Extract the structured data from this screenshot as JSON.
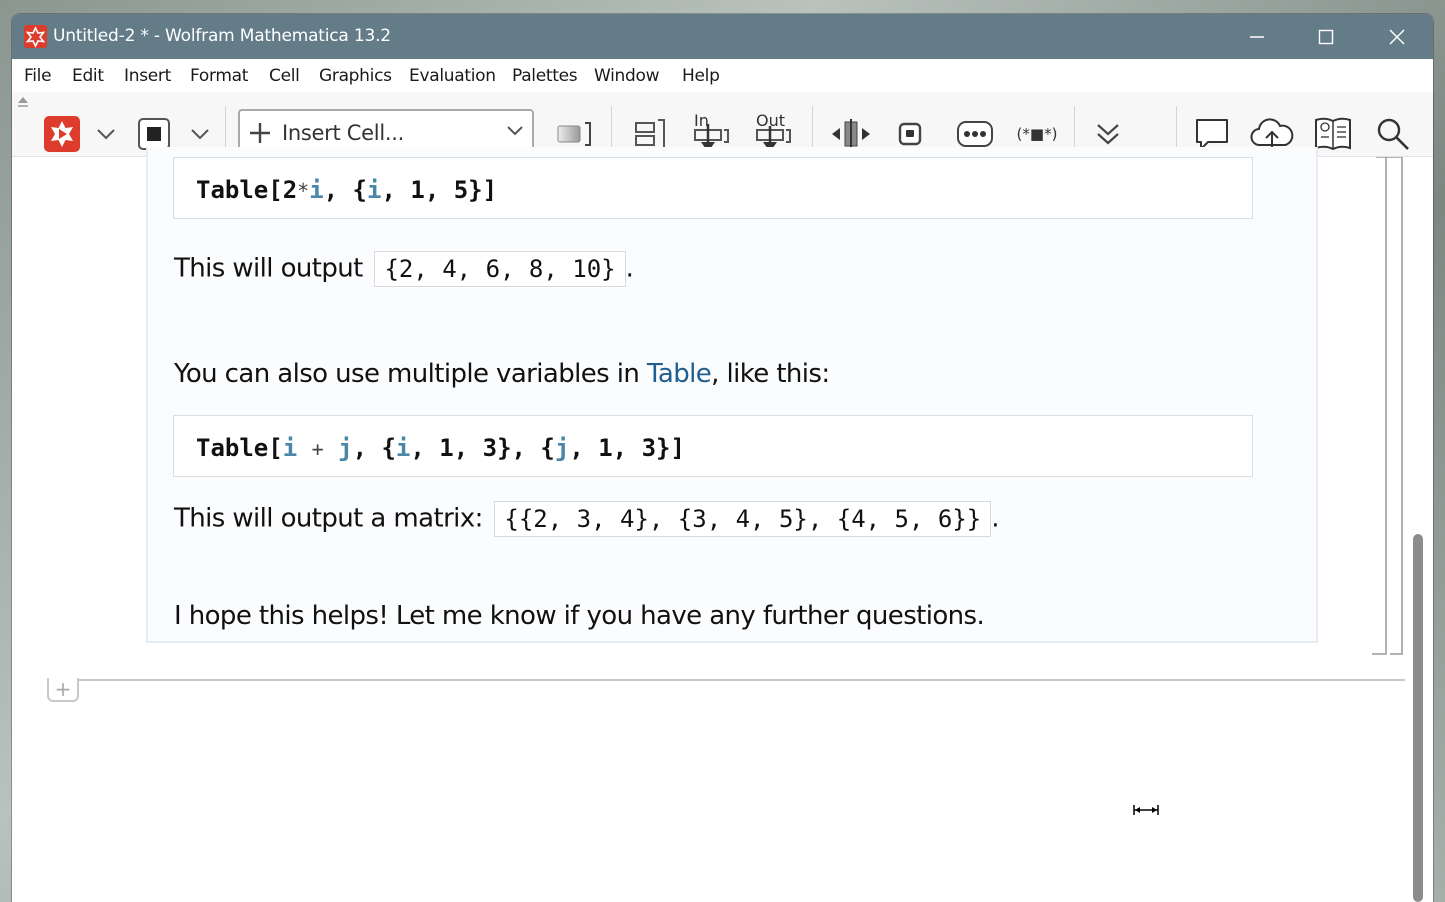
{
  "window": {
    "title": "Untitled-2 * - Wolfram Mathematica 13.2"
  },
  "menu": [
    "File",
    "Edit",
    "Insert",
    "Format",
    "Cell",
    "Graphics",
    "Evaluation",
    "Palettes",
    "Window",
    "Help"
  ],
  "toolbar": {
    "insert_cell_label": "Insert Cell...",
    "in_label": "In",
    "out_label": "Out",
    "comment_label": "(*■*)"
  },
  "notebook": {
    "code1": {
      "head": "Table",
      "text": "[2*i, {i, 1, 5}]"
    },
    "para1": {
      "text": "This will output",
      "output": "{2, 4, 6, 8, 10}",
      "tail": "."
    },
    "para2": {
      "before": "You can also use multiple variables in ",
      "link": "Table",
      "after": ", like this:"
    },
    "code2": {
      "head": "Table",
      "text": "[i + j, {i, 1, 3}, {j, 1, 3}]"
    },
    "para3": {
      "text": "This will output a matrix:",
      "output": "{{2, 3, 4}, {3, 4, 5}, {4, 5, 6}}",
      "tail": "."
    },
    "para4": {
      "text": "I hope this helps! Let me know if you have any further questions."
    },
    "insert_plus": "+"
  },
  "colors": {
    "titlebar": "#647b88",
    "accent": "#dd3c2c",
    "variable": "#4a86a8",
    "link": "#1f5e8f"
  }
}
